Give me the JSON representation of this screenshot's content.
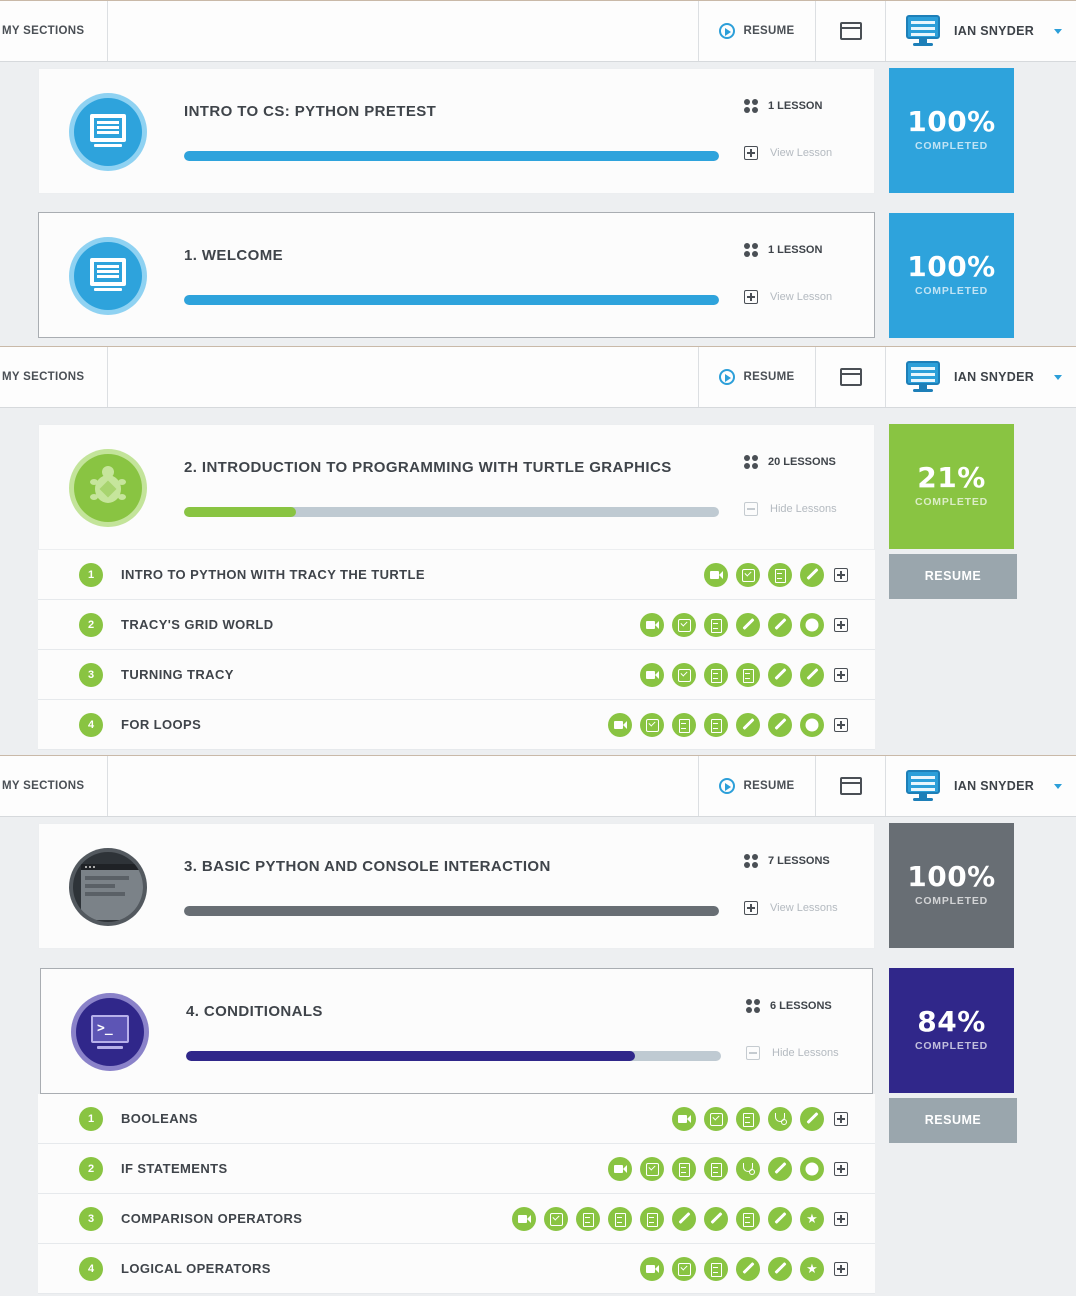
{
  "topbar": {
    "my_sections": "MY SECTIONS",
    "resume": "RESUME",
    "user": "IAN SNYDER",
    "icons": [
      "play-icon",
      "window-icon",
      "computer-avatar-icon",
      "caret-down-icon"
    ]
  },
  "cards": [
    {
      "title": "INTRO TO CS: PYTHON PRETEST",
      "lessons": "1 LESSON",
      "action": "View Lesson",
      "percent": "100%",
      "completed": "COMPLETED",
      "progress": 1.0,
      "color": "#2ea3dc",
      "badge_icon": "computer-icon"
    },
    {
      "title": "1. WELCOME",
      "lessons": "1 LESSON",
      "action": "View Lesson",
      "percent": "100%",
      "completed": "COMPLETED",
      "progress": 1.0,
      "color": "#2ea3dc",
      "badge_icon": "computer-icon"
    },
    {
      "title": "2. INTRODUCTION TO PROGRAMMING WITH TURTLE GRAPHICS",
      "lessons": "20 LESSONS",
      "action": "Hide Lessons",
      "percent": "21%",
      "completed": "COMPLETED",
      "progress": 0.21,
      "color": "#89c442",
      "badge_icon": "turtle-icon",
      "resume": "RESUME"
    },
    {
      "title": "3. BASIC PYTHON AND CONSOLE INTERACTION",
      "lessons": "7 LESSONS",
      "action": "View Lessons",
      "percent": "100%",
      "completed": "COMPLETED",
      "progress": 1.0,
      "color": "#686e74",
      "badge_icon": "console-icon"
    },
    {
      "title": "4. CONDITIONALS",
      "lessons": "6 LESSONS",
      "action": "Hide Lessons",
      "percent": "84%",
      "completed": "COMPLETED",
      "progress": 0.84,
      "color": "#30278a",
      "badge_icon": "terminal-icon",
      "resume": "RESUME"
    }
  ],
  "turtle_lessons": [
    {
      "num": "1",
      "title": "INTRO TO PYTHON WITH TRACY THE TURTLE",
      "icons": [
        "video",
        "check",
        "doc",
        "pencil"
      ]
    },
    {
      "num": "2",
      "title": "TRACY'S GRID WORLD",
      "icons": [
        "video",
        "check",
        "doc",
        "pencil",
        "pencil",
        "badge8"
      ]
    },
    {
      "num": "3",
      "title": "TURNING TRACY",
      "icons": [
        "video",
        "check",
        "doc",
        "doc",
        "pencil",
        "pencil"
      ]
    },
    {
      "num": "4",
      "title": "FOR LOOPS",
      "icons": [
        "video",
        "check",
        "doc",
        "doc",
        "pencil",
        "pencil",
        "badge8"
      ]
    }
  ],
  "conditional_lessons": [
    {
      "num": "1",
      "title": "BOOLEANS",
      "icons": [
        "video",
        "check",
        "doc",
        "steth",
        "pencil"
      ]
    },
    {
      "num": "2",
      "title": "IF STATEMENTS",
      "icons": [
        "video",
        "check",
        "doc",
        "doc",
        "steth",
        "pencil",
        "badge8"
      ]
    },
    {
      "num": "3",
      "title": "COMPARISON OPERATORS",
      "icons": [
        "video",
        "check",
        "doc",
        "doc",
        "doc",
        "pencil",
        "pencil",
        "doc",
        "pencil",
        "star"
      ]
    },
    {
      "num": "4",
      "title": "LOGICAL OPERATORS",
      "icons": [
        "video",
        "check",
        "doc",
        "pencil",
        "pencil",
        "star"
      ]
    }
  ]
}
